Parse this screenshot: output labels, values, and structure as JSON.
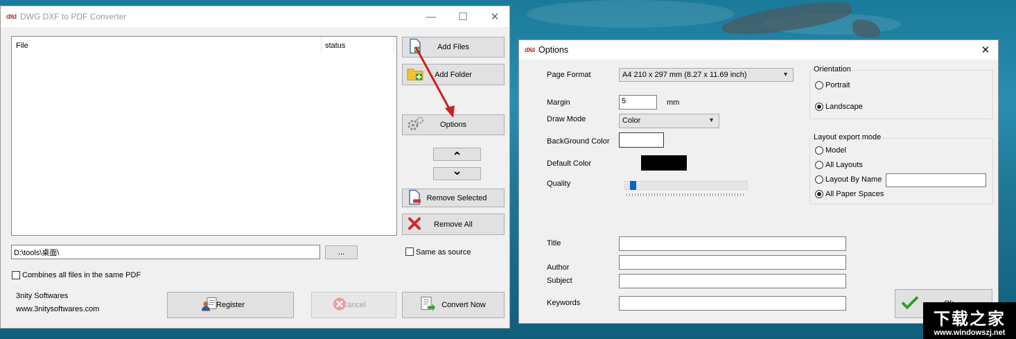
{
  "main_window": {
    "app_icon": "dXd",
    "title": "DWG DXF to PDF Converter",
    "controls": {
      "minimize": "—",
      "maximize": "☐",
      "close": "✕"
    },
    "file_list": {
      "col_file": "File",
      "col_status": "status"
    },
    "buttons": {
      "add_files": "Add Files",
      "add_folder": "Add Folder",
      "options": "Options",
      "move_up": "⌃",
      "move_down": "⌄",
      "remove_selected": "Remove Selected",
      "remove_all": "Remove All",
      "browse": "...",
      "register": "Register",
      "cancel": "Cancel",
      "convert_now": "Convert Now"
    },
    "output_path": "D:\\tools\\桌面\\",
    "same_as_source": "Same as source",
    "combine_files": "Combines all files in the same PDF",
    "company": "3nity Softwares",
    "website": "www.3nitysoftwares.com"
  },
  "options_window": {
    "app_icon": "dXd",
    "title": "Options",
    "close": "✕",
    "page_format_label": "Page Format",
    "page_format_value": "A4 210 x 297 mm (8.27 x 11.69 inch)",
    "margin_label": "Margin",
    "margin_value": "5",
    "margin_unit": "mm",
    "draw_mode_label": "Draw Mode",
    "draw_mode_value": "Color",
    "background_color_label": "BackGround Color",
    "background_color": "#ffffff",
    "default_color_label": "Default Color",
    "default_color": "#000000",
    "quality_label": "Quality",
    "quality_level": 0.04,
    "orientation": {
      "title": "Orientation",
      "portrait": "Portrait",
      "landscape": "Landscape",
      "selected": "landscape"
    },
    "layout_export": {
      "title": "Layout export mode",
      "model": "Model",
      "all_layouts": "All Layouts",
      "layout_by_name": "Layout By Name",
      "all_paper_spaces": "All Paper Spaces",
      "selected": "all_paper_spaces"
    },
    "title_label": "Title",
    "author_label": "Author",
    "subject_label": "Subject",
    "keywords_label": "Keywords",
    "ok_label": "Ok"
  },
  "watermark": {
    "text": "下载之家",
    "url": "www.windowszj.net"
  },
  "colors": {
    "arrow": "#cc1f1f",
    "check_green": "#2e9e2e",
    "folder_yellow": "#f2c230",
    "slider_thumb": "#0a64c8"
  }
}
